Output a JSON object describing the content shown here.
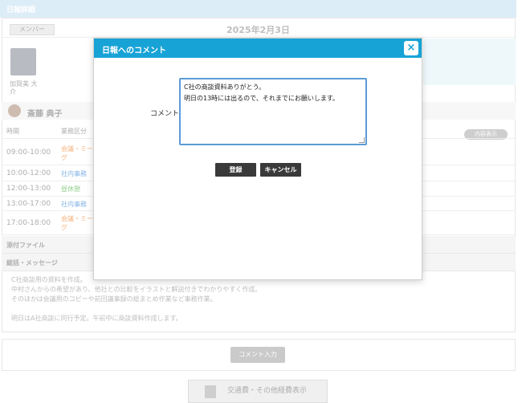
{
  "page": {
    "header_title": "日報詳細",
    "member_button": "メンバー",
    "date": "2025年2月3日",
    "member_name": "加賀美 大介",
    "person_name": "斎藤 典子",
    "columns": {
      "time": "時間",
      "category": "業務区分"
    },
    "content_toggle": "内容表示",
    "rows": [
      {
        "time": "09:00-10:00",
        "category": "会議・ミーグ",
        "color": "#f6b07a"
      },
      {
        "time": "10:00-12:00",
        "category": "社内事務",
        "color": "#7fb0e6"
      },
      {
        "time": "12:00-13:00",
        "category": "昼休憩",
        "color": "#8fce8a"
      },
      {
        "time": "13:00-17:00",
        "category": "社内事務",
        "color": "#7fb0e6"
      },
      {
        "time": "17:00-18:00",
        "category": "会議・ミーグ",
        "color": "#f6b07a"
      }
    ],
    "attachments_label": "添付ファイル",
    "summary_label": "総括・メッセージ",
    "summary_text": "C社商談用の資料を作成。\n中村さんからの希望があり、他社との比較をイラストと解説付きでわかりやすく作成。\nそのほかは会議用のコピーや前回議事録の総まとめ作業など事務作業。\n\n明日はA社商談に同行予定。午前中に商談資料作成します。",
    "comment_input_button": "コメント入力",
    "expense_button": "交通費・その他経費表示"
  },
  "modal": {
    "title": "日報へのコメント",
    "close": "×",
    "field_label": "コメント",
    "comment_value": "C社の商談資料ありがとう。\n明日の13時には出るので、それまでにお願いします。",
    "submit": "登録",
    "cancel": "キャンセル"
  },
  "colors": {
    "accent": "#18a3d6",
    "button_dark": "#3a3a3a",
    "focus_border": "#5b9bd5"
  }
}
